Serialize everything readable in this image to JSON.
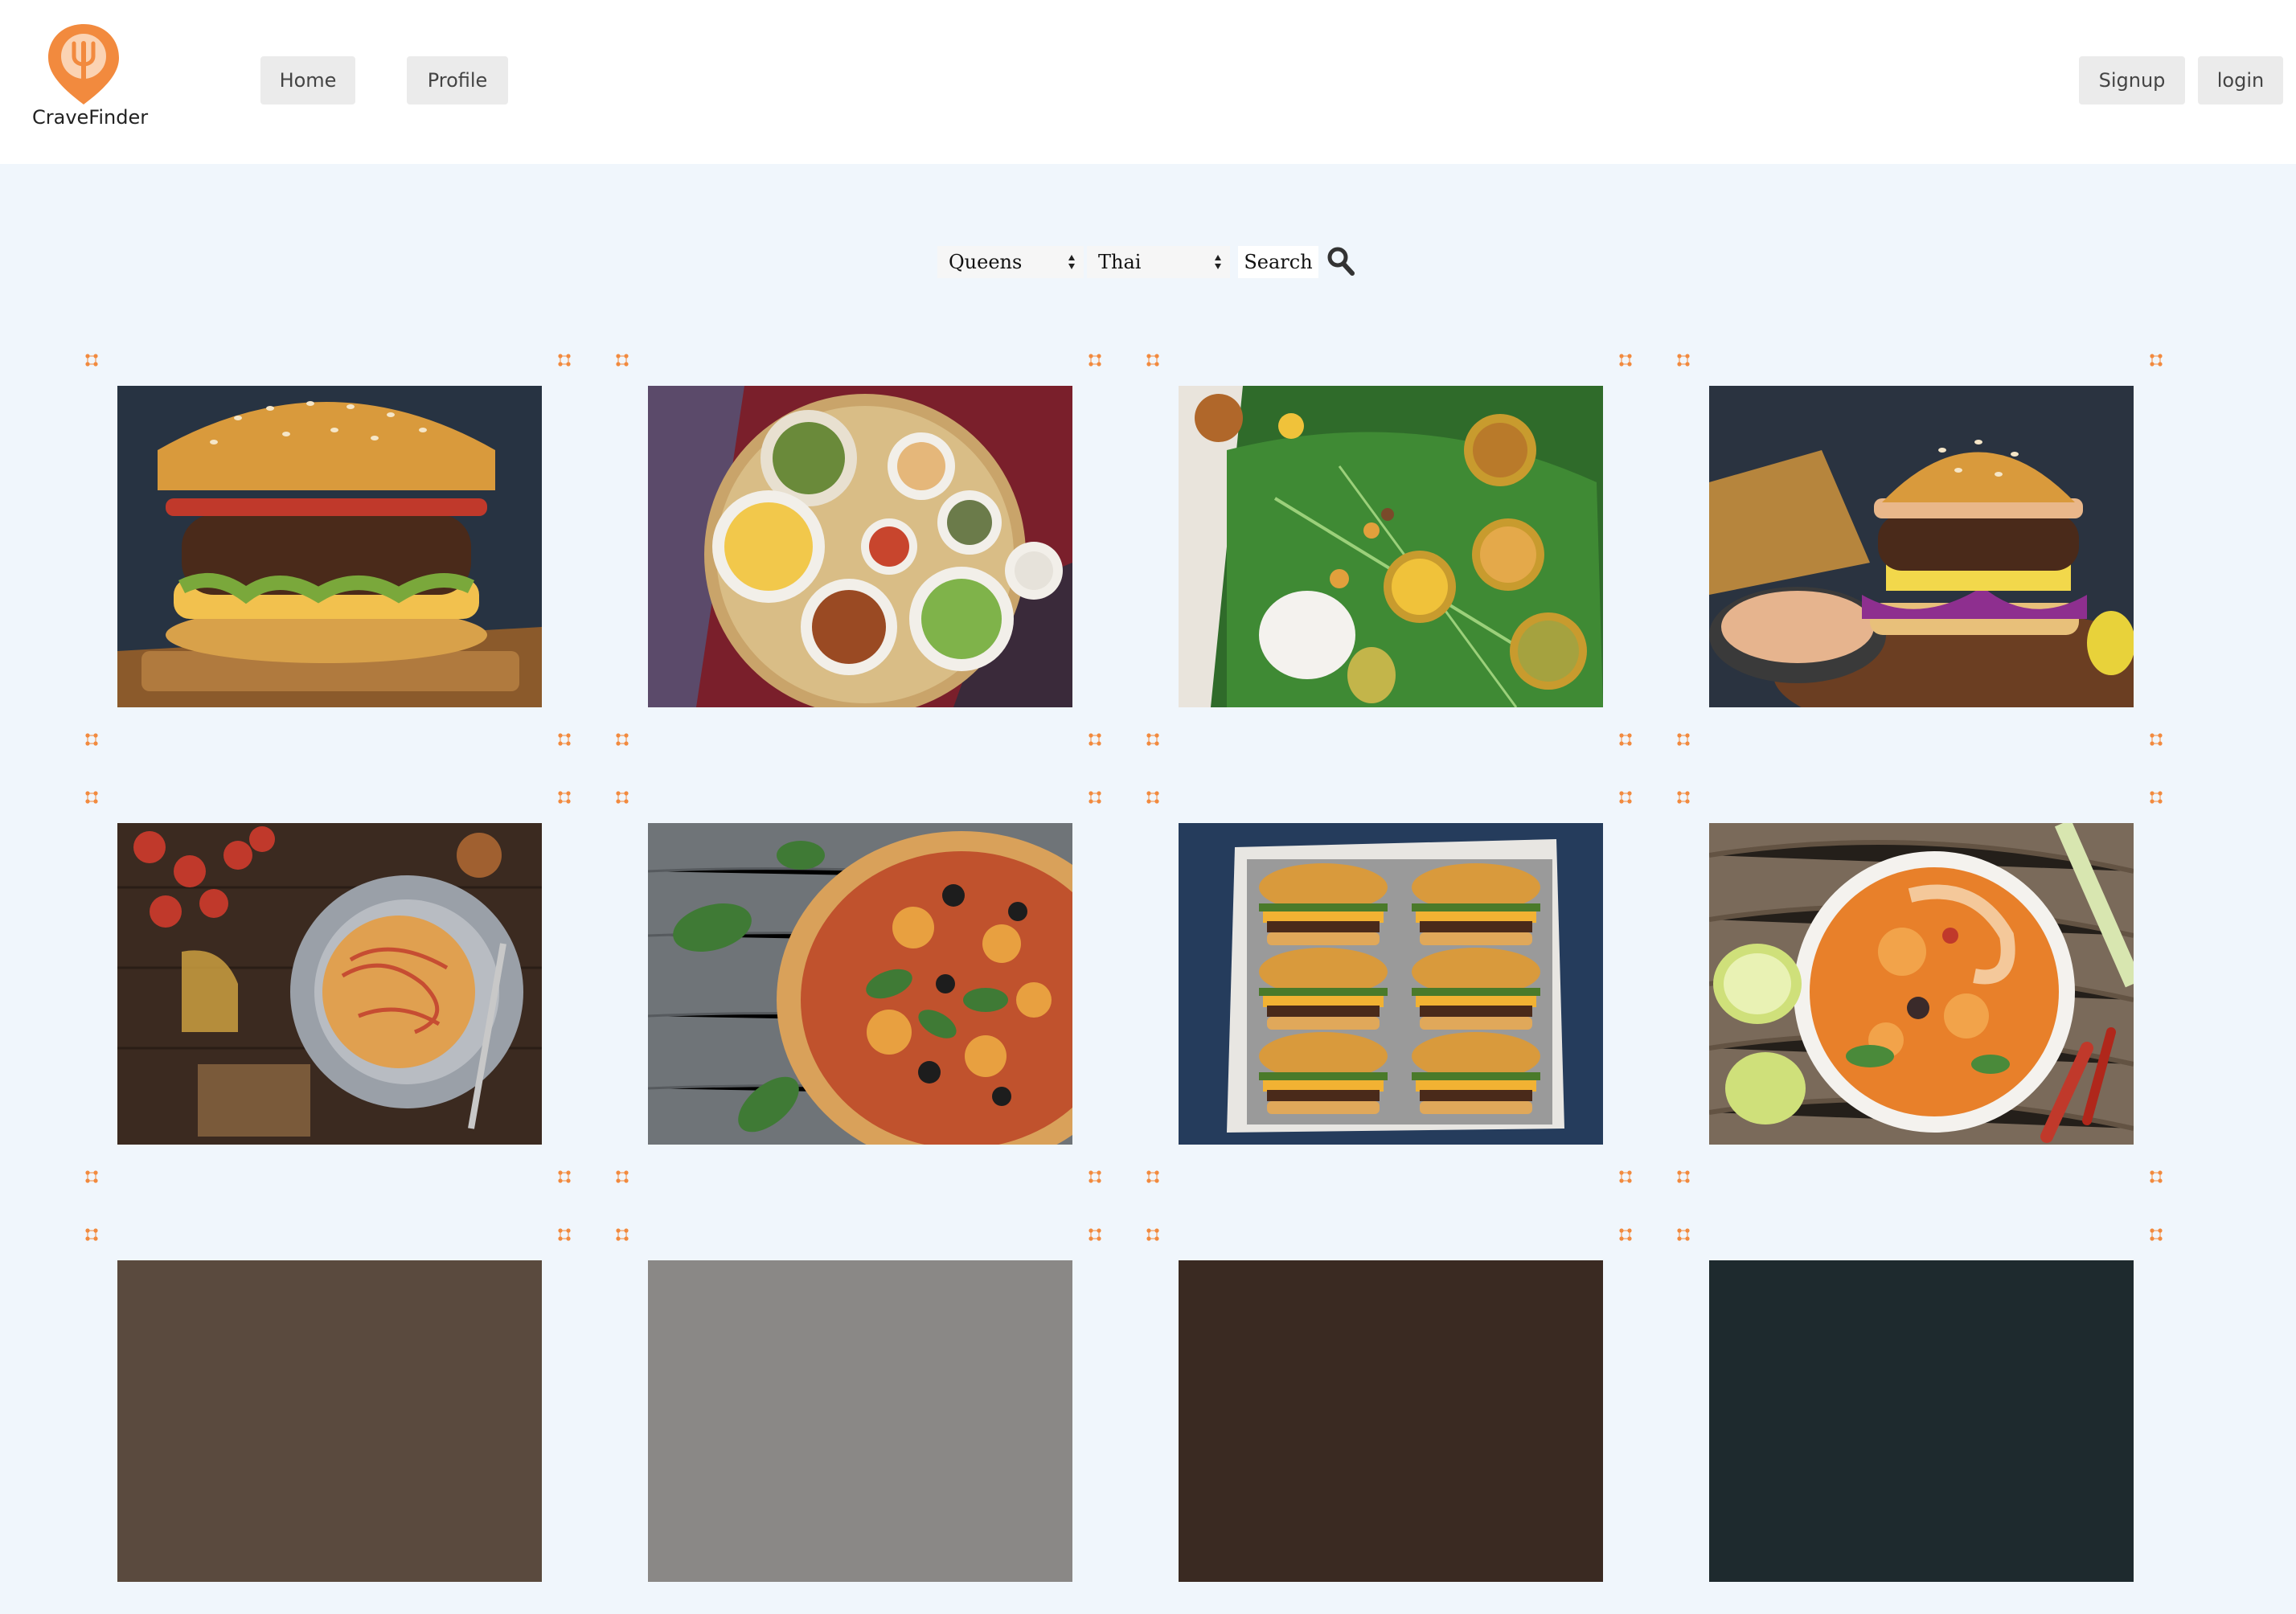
{
  "brand": {
    "name": "CraveFinder",
    "accent": "#f28a3e"
  },
  "nav": {
    "home": "Home",
    "profile": "Profile",
    "signup": "Signup",
    "login": "login"
  },
  "search": {
    "borough": "Queens",
    "cuisine": "Thai",
    "button": "Search",
    "icon": "magnifier-icon"
  },
  "colors": {
    "page_bg": "#f0f6fc",
    "header_bg": "#ffffff",
    "button_bg": "#ebebeb",
    "handle": "#f28a3e"
  },
  "cards": [
    {
      "subject": "burger-on-board"
    },
    {
      "subject": "thai-platter"
    },
    {
      "subject": "banana-leaf-meal"
    },
    {
      "subject": "burger-with-dip"
    },
    {
      "subject": "spaghetti-plate"
    },
    {
      "subject": "pizza-on-wood"
    },
    {
      "subject": "sliders-tray"
    },
    {
      "subject": "tom-yum-soup"
    },
    {
      "subject": "partial"
    },
    {
      "subject": "partial"
    },
    {
      "subject": "partial"
    },
    {
      "subject": "partial"
    }
  ]
}
